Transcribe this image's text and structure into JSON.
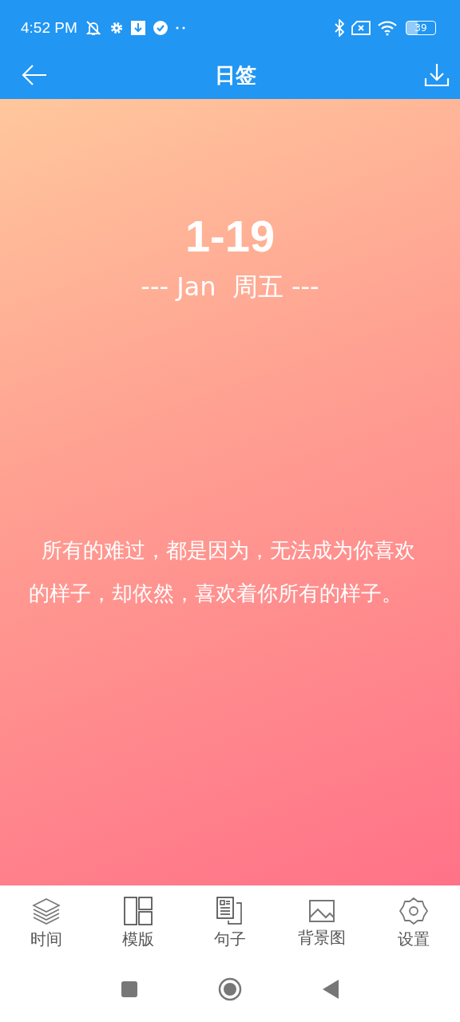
{
  "status_bar": {
    "time": "4:52 PM",
    "battery": "39"
  },
  "app_bar": {
    "title": "日签"
  },
  "card": {
    "date": "1-19",
    "subtitle": "--- Jan  周五 ---",
    "quote": "所有的难过，都是因为，无法成为你喜欢的样子，却依然，喜欢着你所有的样子。"
  },
  "bottom_nav": [
    {
      "label": "时间"
    },
    {
      "label": "模版"
    },
    {
      "label": "句子"
    },
    {
      "label": "背景图"
    },
    {
      "label": "设置"
    }
  ]
}
